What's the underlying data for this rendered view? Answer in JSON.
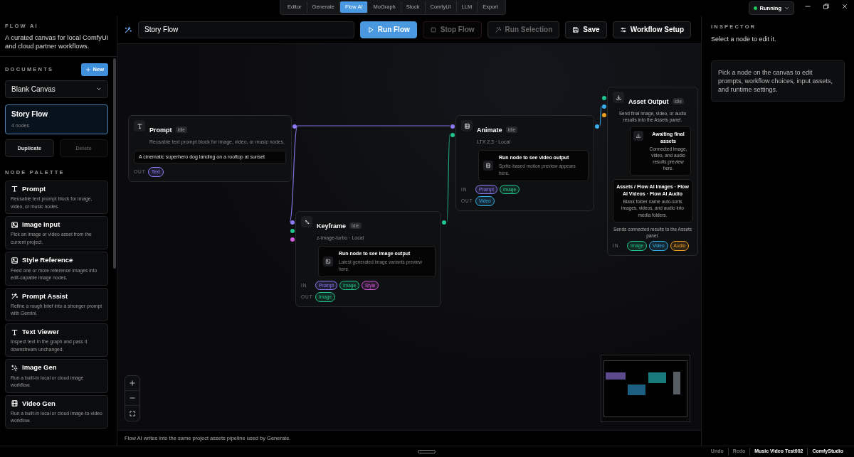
{
  "top_tabs": [
    {
      "label": "Editor",
      "selected": false
    },
    {
      "label": "Generate",
      "selected": false
    },
    {
      "label": "Flow AI",
      "selected": true
    },
    {
      "label": "MoGraph",
      "selected": false
    },
    {
      "label": "Stock",
      "selected": false
    },
    {
      "label": "ComfyUI",
      "selected": false
    },
    {
      "label": "LLM",
      "selected": false
    },
    {
      "label": "Export",
      "selected": false
    }
  ],
  "status": {
    "label": "Running",
    "color": "#22c55e"
  },
  "sidebar": {
    "section_label": "FLOW AI",
    "description": "A curated canvas for local ComfyUI and cloud partner workflows.",
    "documents": {
      "label": "DOCUMENTS",
      "new_button": "New",
      "select_value": "Blank Canvas",
      "items": [
        {
          "title": "Story Flow",
          "meta": "4 nodes",
          "selected": true
        }
      ],
      "actions": [
        {
          "label": "Duplicate",
          "disabled": false
        },
        {
          "label": "Delete",
          "disabled": true
        }
      ]
    },
    "palette": {
      "label": "NODE PALETTE",
      "items": [
        {
          "kind": "text",
          "title": "Prompt",
          "description": "Reusable text prompt block for image, video, or music nodes."
        },
        {
          "kind": "image",
          "title": "Image Input",
          "description": "Pick an image or video asset from the current project."
        },
        {
          "kind": "image",
          "title": "Style Reference",
          "description": "Feed one or more reference images into edit-capable image nodes."
        },
        {
          "kind": "assist",
          "title": "Prompt Assist",
          "description": "Refine a rough brief into a stronger prompt with Gemini."
        },
        {
          "kind": "text",
          "title": "Text Viewer",
          "description": "Inspect text in the graph and pass it downstream unchanged."
        },
        {
          "kind": "generate",
          "title": "Image Gen",
          "description": "Run a built-in local or cloud image workflow."
        },
        {
          "kind": "video",
          "title": "Video Gen",
          "description": "Run a built-in local or cloud image-to-video workflow."
        }
      ]
    }
  },
  "toolbar": {
    "title_value": "Story Flow",
    "buttons": [
      {
        "kind": "run",
        "label": "Run Flow",
        "disabled": false
      },
      {
        "kind": "stop",
        "label": "Stop Flow",
        "disabled": true
      },
      {
        "kind": "selection",
        "label": "Run Selection",
        "disabled": true
      },
      {
        "kind": "save",
        "label": "Save",
        "disabled": false
      },
      {
        "kind": "setup",
        "label": "Workflow Setup",
        "disabled": false
      }
    ]
  },
  "canvas": {
    "nodes": [
      {
        "kind": "prompt",
        "title": "Prompt",
        "badge": "Idle",
        "subtitle": "Reusable text prompt block for image, video, or music nodes.",
        "prompt_text": "A cinematic superhero dog landing on a rooftop at sunset",
        "outputs_label": "OUT",
        "outputs": [
          {
            "label": "Text",
            "color": "#8b7cf6"
          }
        ]
      },
      {
        "kind": "keyframe",
        "title": "Keyframe",
        "badge": "Idle",
        "subtitle": "z-image-turbo · Local",
        "preview": {
          "title": "Run node to see image output",
          "text": "Latest generated image variants preview here."
        },
        "inputs_label": "IN",
        "outputs_label": "OUT",
        "inputs": [
          {
            "label": "Prompt",
            "color": "#8b7cf6"
          },
          {
            "label": "Image",
            "color": "#22c58b"
          },
          {
            "label": "Style",
            "color": "#d45cdc"
          }
        ],
        "outputs": [
          {
            "label": "Image",
            "color": "#22c58b"
          }
        ]
      },
      {
        "kind": "animate",
        "title": "Animate",
        "badge": "Idle",
        "subtitle": "LTX 2.3 · Local",
        "preview": {
          "title": "Run node to see video output",
          "text": "Sprite-based motion preview appears here."
        },
        "inputs_label": "IN",
        "outputs_label": "OUT",
        "inputs": [
          {
            "label": "Prompt",
            "color": "#8b7cf6"
          },
          {
            "label": "Image",
            "color": "#22c58b"
          }
        ],
        "outputs": [
          {
            "label": "Video",
            "color": "#38aee8"
          }
        ]
      },
      {
        "kind": "output",
        "title": "Asset Output",
        "badge": "Idle",
        "subtitle": "Send final image, video, or audio results into the Assets panel.",
        "preview": {
          "title": "Awaiting final assets",
          "text": "Connected image, video, and audio results preview here."
        },
        "folder": {
          "title": "Assets / Flow AI Images · Flow AI Videos · Flow AI Audio",
          "text": "Blank folder name auto-sorts images, videos, and audio into media folders."
        },
        "note": "Sends connected results to the Assets panel.",
        "inputs_label": "IN",
        "inputs": [
          {
            "label": "Image",
            "color": "#22c58b"
          },
          {
            "label": "Video",
            "color": "#38aee8"
          },
          {
            "label": "Audio",
            "color": "#f0a020"
          }
        ]
      }
    ]
  },
  "footer_note": "Flow AI writes into the same project assets pipeline used by Generate.",
  "inspector": {
    "label": "INSPECTOR",
    "subtitle": "Select a node to edit it.",
    "hint": "Pick a node on the canvas to edit prompts, workflow choices, input assets, and runtime settings."
  },
  "bottom_bar": {
    "items": [
      {
        "label": "Undo",
        "kind": "action"
      },
      {
        "label": "Redo",
        "kind": "action"
      },
      {
        "label": "Music Video Test002",
        "kind": "project"
      },
      {
        "label": "ComfyStudio",
        "kind": "app"
      }
    ]
  }
}
